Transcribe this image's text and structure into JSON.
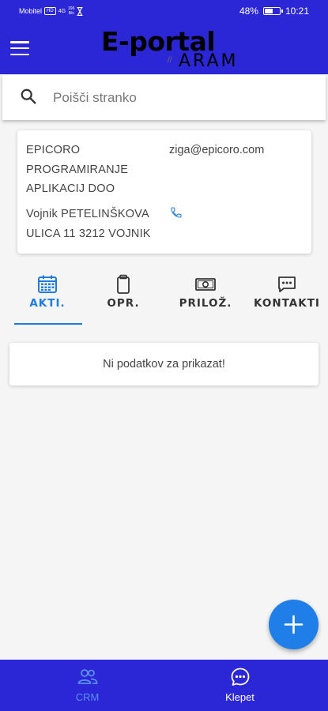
{
  "status_bar": {
    "carrier": "Mobitel",
    "network_badge": "HD",
    "signal": "4G",
    "speed_value": "196",
    "speed_unit": "B/s",
    "battery_percent": "48%",
    "battery_level": 0.48,
    "time": "10:21"
  },
  "header": {
    "logo_title": "E-portal",
    "logo_subtitle": "ARAM",
    "logo_mark": "//",
    "menu_icon": "hamburger-icon",
    "bar_color": "#2b26d6"
  },
  "search": {
    "icon": "search-icon",
    "placeholder": "Poišči stranko",
    "value": ""
  },
  "contact_card": {
    "company_name": "EPICORO PROGRAMIRANJE APLIKACIJ DOO",
    "email": "ziga@epicoro.com",
    "address": "Vojnik PETELINŠKOVA ULICA 11 3212 VOJNIK",
    "phone_icon": "phone-icon"
  },
  "tabs": [
    {
      "label": "AKTI.",
      "icon": "calendar-icon",
      "active": true
    },
    {
      "label": "OPR.",
      "icon": "clipboard-icon",
      "active": false
    },
    {
      "label": "PRILOŽ.",
      "icon": "money-icon",
      "active": false
    },
    {
      "label": "KONTAKTI",
      "icon": "chat-icon",
      "active": false
    }
  ],
  "empty_state": {
    "message": "Ni podatkov za prikazat!"
  },
  "fab": {
    "icon": "plus-icon",
    "color": "#1f7ee8"
  },
  "bottom_nav": {
    "items": [
      {
        "label": "CRM",
        "icon": "people-icon",
        "active": true
      },
      {
        "label": "Klepet",
        "icon": "chat-bubble-icon",
        "active": false
      }
    ]
  },
  "colors": {
    "primary": "#2b26d6",
    "accent": "#1e7be0",
    "crm_active": "#5b8ef0"
  }
}
